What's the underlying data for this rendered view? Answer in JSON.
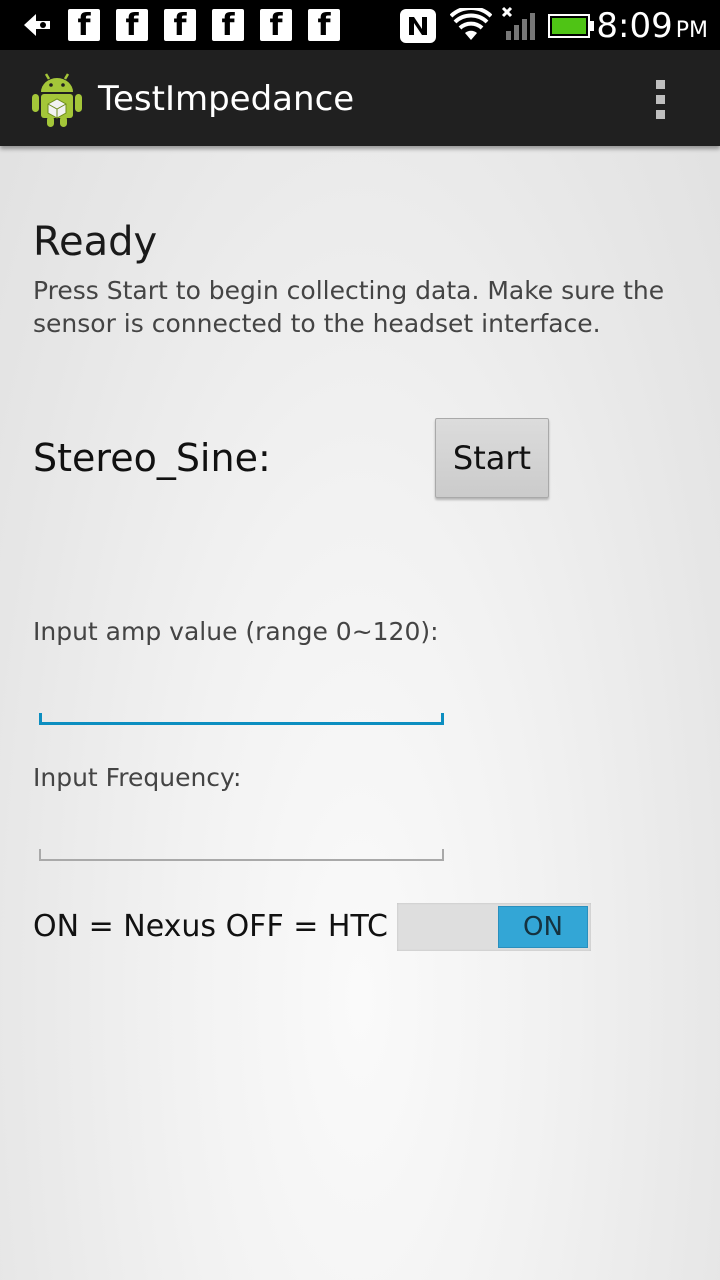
{
  "status_bar": {
    "time": "8:09",
    "ampm": "PM",
    "icons": [
      "back-arrow-icon",
      "facebook-icon",
      "facebook-icon",
      "facebook-icon",
      "facebook-icon",
      "facebook-icon",
      "facebook-icon",
      "nfc-icon",
      "wifi-icon",
      "signal-icon",
      "battery-icon"
    ],
    "facebook_glyph": "f"
  },
  "action_bar": {
    "title": "TestImpedance"
  },
  "main": {
    "status_title": "Ready",
    "status_message": "Press Start to begin collecting data. Make sure the sensor is connected to the headset interface.",
    "stereo_label": "Stereo_Sine:",
    "start_label": "Start",
    "amp_label": "Input amp value (range 0~120):",
    "amp_value": "",
    "freq_label": "Input Frequency:",
    "freq_value": "",
    "toggle_label": "ON = Nexus OFF = HTC",
    "toggle_state": "ON"
  },
  "colors": {
    "accent": "#33a6d6",
    "edit_focus": "#0c8ec0",
    "android_green": "#a4c639"
  }
}
